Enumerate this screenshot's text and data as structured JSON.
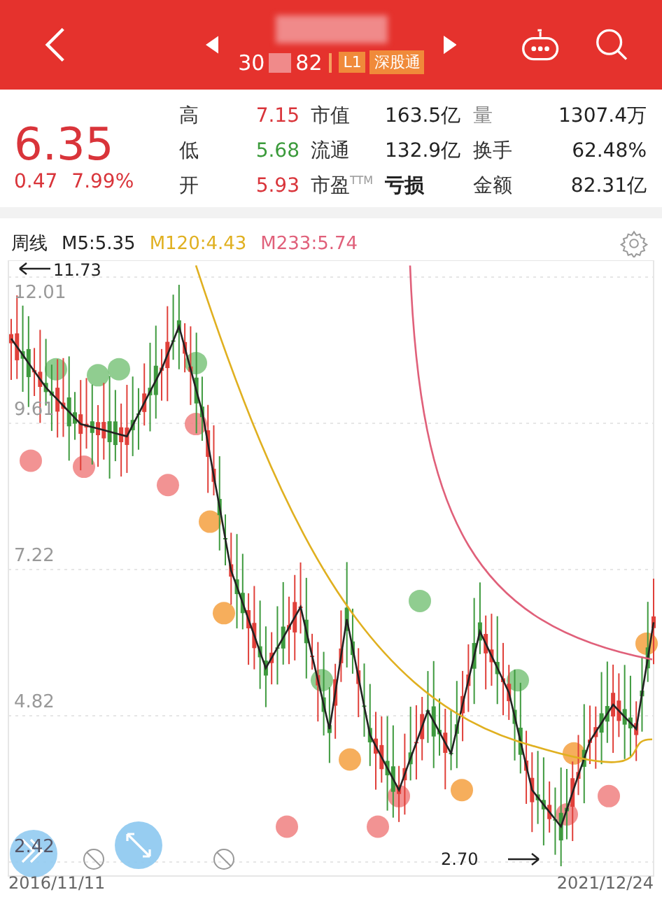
{
  "header": {
    "code_start": "30",
    "code_end": "82",
    "tags": [
      "L1",
      "深股通"
    ]
  },
  "quote": {
    "price": "6.35",
    "change": "0.47",
    "change_pct": "7.99%"
  },
  "stats": [
    {
      "label": "高",
      "value": "7.15",
      "color": "#d9343a",
      "m1_label": "市值",
      "m1_value": "163.5亿",
      "m2_label": "量",
      "m2_value": "1307.4万"
    },
    {
      "label": "低",
      "value": "5.68",
      "color": "#3a9a3a",
      "m1_label": "流通",
      "m1_value": "132.9亿",
      "m2_label": "换手",
      "m2_value": "62.48%"
    },
    {
      "label": "开",
      "value": "5.93",
      "color": "#d9343a",
      "m1_label": "市盈$^{TTM}$",
      "m1_value": "亏损",
      "m2_label": "金额",
      "m2_value": "82.31亿"
    }
  ],
  "chart": {
    "period": "周线",
    "legend": [
      {
        "text": "M5:5.35",
        "color": "#222222"
      },
      {
        "text": "M120:4.43",
        "color": "#e0b020"
      },
      {
        "text": "M233:5.74",
        "color": "#e0607a"
      }
    ],
    "y_labels": [
      "12.01",
      "9.61",
      "7.22",
      "4.82",
      "2.42"
    ],
    "max_label": "11.73",
    "min_label": "2.70",
    "start_date": "2016/11/11",
    "end_date": "2021/12/24"
  }
}
